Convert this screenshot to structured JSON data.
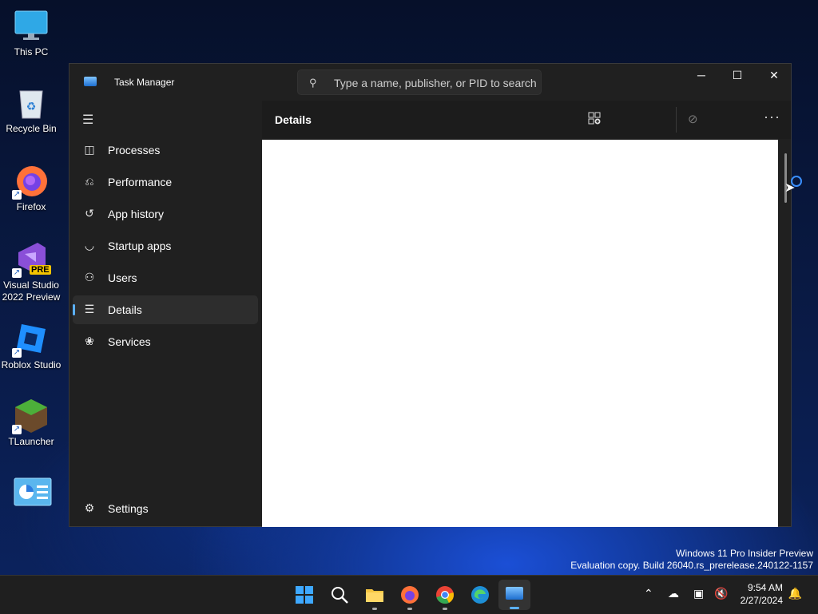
{
  "desktop": {
    "icons": [
      {
        "label": "This PC",
        "icon": "monitor-icon"
      },
      {
        "label": "Recycle Bin",
        "icon": "recycle-bin-icon"
      },
      {
        "label": "Firefox",
        "icon": "firefox-icon"
      },
      {
        "label": "Visual Studio 2022 Preview",
        "badge": "PRE",
        "icon": "visual-studio-icon"
      },
      {
        "label": "Roblox Studio",
        "icon": "roblox-studio-icon"
      },
      {
        "label": "TLauncher",
        "icon": "tlauncher-icon"
      },
      {
        "label": "",
        "icon": "control-panel-icon"
      }
    ]
  },
  "window": {
    "title": "Task Manager",
    "search_placeholder": "Type a name, publisher, or PID to search",
    "controls": {
      "minimize": "─",
      "maximize": "☐",
      "close": "✕"
    }
  },
  "sidebar": {
    "menu_icon": "☰",
    "items": [
      {
        "label": "Processes",
        "icon": "processes-icon"
      },
      {
        "label": "Performance",
        "icon": "performance-icon"
      },
      {
        "label": "App history",
        "icon": "history-icon"
      },
      {
        "label": "Startup apps",
        "icon": "startup-icon"
      },
      {
        "label": "Users",
        "icon": "users-icon"
      },
      {
        "label": "Details",
        "icon": "details-icon",
        "active": true
      },
      {
        "label": "Services",
        "icon": "services-icon"
      }
    ],
    "settings": "Settings"
  },
  "main": {
    "page_title": "Details",
    "more": "···"
  },
  "watermark": {
    "line1": "Windows 11 Pro Insider Preview",
    "line2": "Evaluation copy. Build 26040.rs_prerelease.240122-1157"
  },
  "taskbar": {
    "time": "9:54 AM",
    "date": "2/27/2024"
  },
  "colors": {
    "accent": "#5bb0ff",
    "window_bg": "#202020",
    "taskbar_bg": "#1f1f1f"
  }
}
